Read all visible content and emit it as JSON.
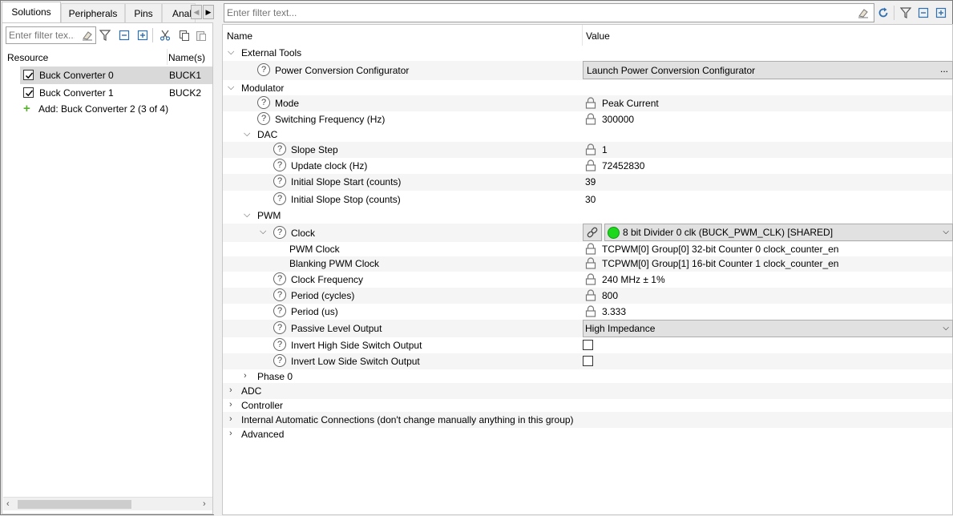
{
  "left": {
    "tabs": [
      "Solutions",
      "Peripherals",
      "Pins",
      "Anal"
    ],
    "filter_placeholder": "Enter filter tex...",
    "columns": [
      "Resource",
      "Name(s)"
    ],
    "rows": [
      {
        "resource": "Buck Converter 0",
        "name": "BUCK1",
        "checked": true
      },
      {
        "resource": "Buck Converter 1",
        "name": "BUCK2",
        "checked": true
      }
    ],
    "add_label": "Add: Buck Converter 2 (3 of 4)"
  },
  "right": {
    "filter_placeholder": "Enter filter text...",
    "columns": [
      "Name",
      "Value"
    ],
    "external_tools": "External Tools",
    "power_conversion_configurator": "Power Conversion Configurator",
    "launch_button": "Launch Power Conversion Configurator",
    "launch_dots": "...",
    "modulator": "Modulator",
    "mode_label": "Mode",
    "mode_value": "Peak Current",
    "switching_freq_label": "Switching Frequency (Hz)",
    "switching_freq_value": "300000",
    "dac": "DAC",
    "slope_step_label": "Slope Step",
    "slope_step_value": "1",
    "update_clock_label": "Update clock (Hz)",
    "update_clock_value": "72452830",
    "slope_start_label": "Initial Slope Start (counts)",
    "slope_start_value": "39",
    "slope_stop_label": "Initial Slope Stop (counts)",
    "slope_stop_value": "30",
    "pwm": "PWM",
    "clock_label": "Clock",
    "clock_value": "8 bit Divider 0 clk (BUCK_PWM_CLK) [SHARED]",
    "pwm_clock_label": "PWM Clock",
    "pwm_clock_value": "TCPWM[0] Group[0] 32-bit Counter 0 clock_counter_en",
    "blanking_clock_label": "Blanking PWM Clock",
    "blanking_clock_value": "TCPWM[0] Group[1] 16-bit Counter 1 clock_counter_en",
    "clock_freq_label": "Clock Frequency",
    "clock_freq_value": "240 MHz ± 1%",
    "period_cycles_label": "Period (cycles)",
    "period_cycles_value": "800",
    "period_us_label": "Period (us)",
    "period_us_value": "3.333",
    "passive_level_label": "Passive Level Output",
    "passive_level_value": "High Impedance",
    "invert_high_label": "Invert High Side Switch Output",
    "invert_high_checked": false,
    "invert_low_label": "Invert Low Side Switch Output",
    "invert_low_checked": false,
    "phase0": "Phase 0",
    "adc": "ADC",
    "controller": "Controller",
    "internal_connections": "Internal Automatic Connections (don't change manually anything in this group)",
    "advanced": "Advanced"
  }
}
